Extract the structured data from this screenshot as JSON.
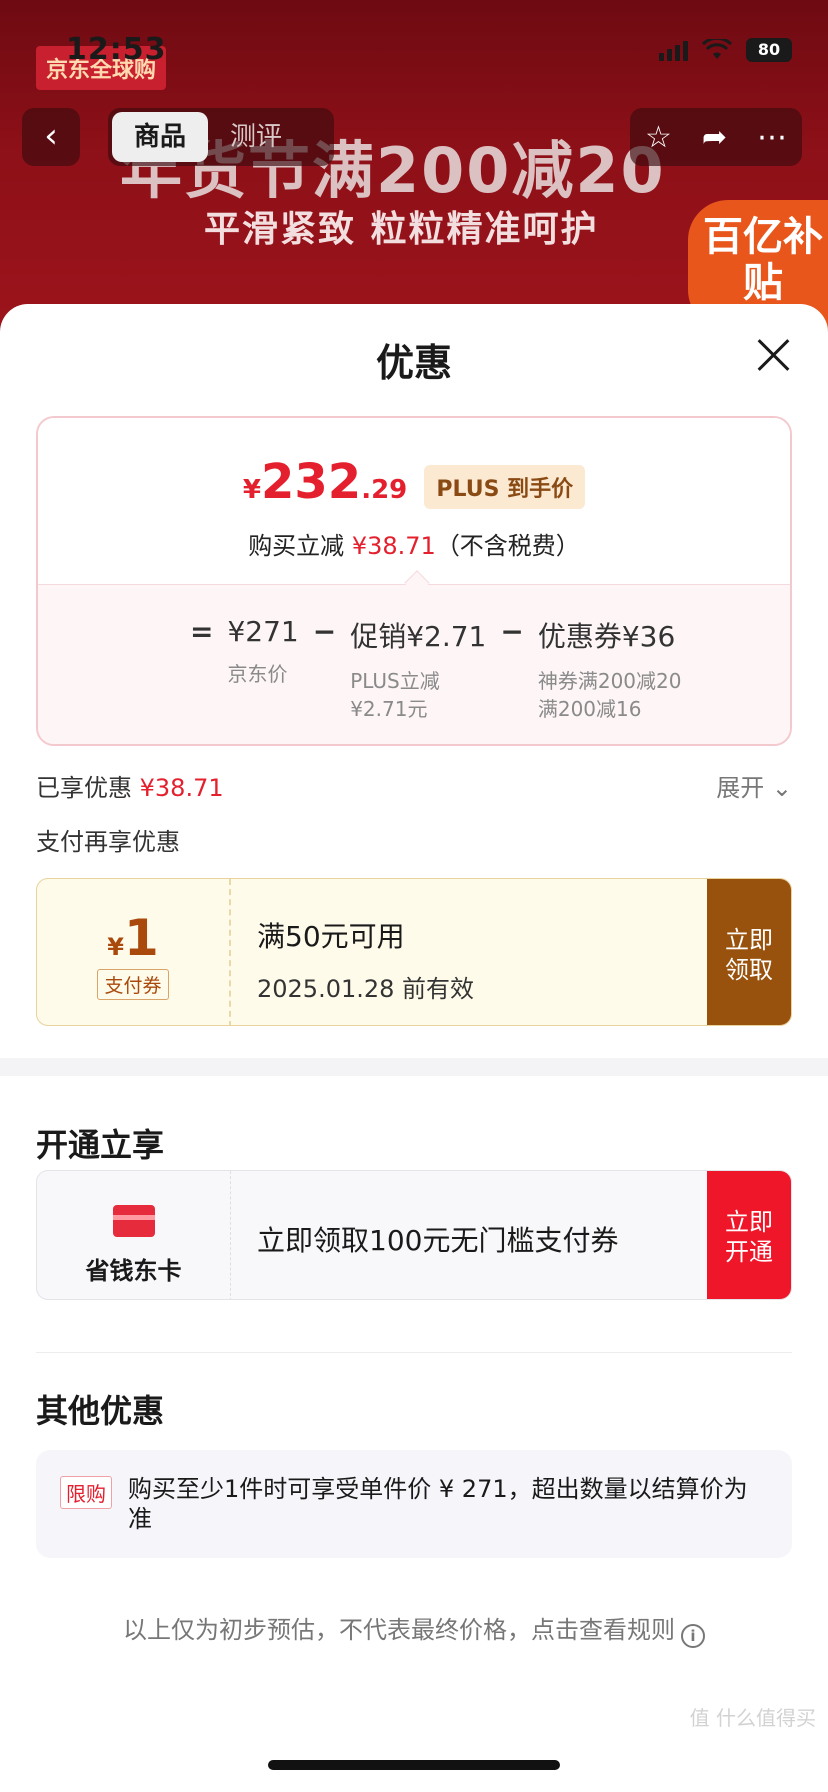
{
  "status_bar": {
    "time": "12:53",
    "battery": "80"
  },
  "background": {
    "store_badge": "京东全球购",
    "tabs": [
      "商品",
      "测评"
    ],
    "promo_title": "年货节满200减20",
    "promo_sub": "平滑紧致 粒粒精准呵护",
    "subsidy_label": "百亿补贴"
  },
  "sheet": {
    "title": "优惠",
    "price": {
      "yen": "¥",
      "integer": "232",
      "decimal": ".29",
      "tag": "PLUS 到手价"
    },
    "price_note_prefix": "购买立减 ",
    "price_note_amount": "¥38.71",
    "price_note_suffix": "（不含税费）",
    "formula": {
      "eq": "=",
      "base": "¥271",
      "base_label": "京东价",
      "minus": "−",
      "promo": "促销¥2.71",
      "promo_label_1": "PLUS立减",
      "promo_label_2": "¥2.71元",
      "coupon": "优惠券¥36",
      "coupon_label_1": "神券满200减20",
      "coupon_label_2": "满200减16"
    },
    "enjoyed_label": "已享优惠 ",
    "enjoyed_amount": "¥38.71",
    "expand_label": "展开",
    "pay_more_label": "支付再享优惠",
    "pay_coupon": {
      "yen": "¥",
      "amount": "1",
      "type": "支付券",
      "condition": "满50元可用",
      "expiry": "2025.01.28 前有效",
      "button_line1": "立即",
      "button_line2": "领取"
    },
    "open_section_title": "开通立享",
    "card_offer": {
      "label": "省钱东卡",
      "text": "立即领取100元无门槛支付券",
      "button_line1": "立即",
      "button_line2": "开通"
    },
    "other_section_title": "其他优惠",
    "limit": {
      "tag": "限购",
      "text": "购买至少1件时可享受单件价 ¥ 271，超出数量以结算价为准"
    },
    "footnote": "以上仅为初步预估，不代表最终价格，点击查看规则"
  },
  "watermark": "值 什么值得买"
}
